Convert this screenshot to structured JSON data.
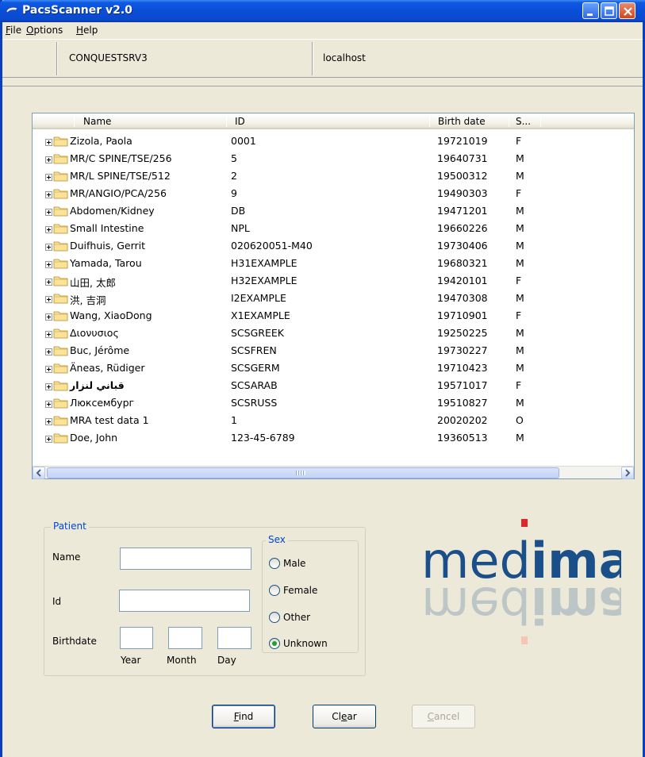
{
  "window": {
    "title": "PacsScanner v2.0"
  },
  "menu": [
    {
      "label": "File",
      "accel": "F",
      "rest": "ile"
    },
    {
      "label": "Options",
      "accel": "O",
      "rest": "ptions"
    },
    {
      "label": "Help",
      "accel": "H",
      "rest": "elp"
    }
  ],
  "server": {
    "ae_title": "CONQUESTSRV3",
    "host": "localhost"
  },
  "tree": {
    "columns": {
      "name": "Name",
      "id": "ID",
      "birth": "Birth date",
      "sex": "S..."
    },
    "rows": [
      {
        "name": "Zizola, Paola",
        "id": "0001",
        "birth": "19721019",
        "sex": "F"
      },
      {
        "name": "MR/C SPINE/TSE/256",
        "id": "5",
        "birth": "19640731",
        "sex": "M"
      },
      {
        "name": "MR/L SPINE/TSE/512",
        "id": "2",
        "birth": "19500312",
        "sex": "M"
      },
      {
        "name": "MR/ANGIO/PCA/256",
        "id": "9",
        "birth": "19490303",
        "sex": "F"
      },
      {
        "name": "Abdomen/Kidney",
        "id": "DB",
        "birth": "19471201",
        "sex": "M"
      },
      {
        "name": "Small Intestine",
        "id": "NPL",
        "birth": "19660226",
        "sex": "M"
      },
      {
        "name": "Duifhuis, Gerrit",
        "id": "020620051-M40",
        "birth": "19730406",
        "sex": "M"
      },
      {
        "name": "Yamada, Tarou",
        "id": "H31EXAMPLE",
        "birth": "19680321",
        "sex": "M"
      },
      {
        "name": "山田, 太郎",
        "id": "H32EXAMPLE",
        "birth": "19420101",
        "sex": "F"
      },
      {
        "name": "洪, 吉洞",
        "id": "I2EXAMPLE",
        "birth": "19470308",
        "sex": "M"
      },
      {
        "name": "Wang, XiaoDong",
        "id": "X1EXAMPLE",
        "birth": "19710901",
        "sex": "F"
      },
      {
        "name": "Διονυσιος",
        "id": "SCSGREEK",
        "birth": "19250225",
        "sex": "M"
      },
      {
        "name": "Buc, Jérôme",
        "id": "SCSFREN",
        "birth": "19730227",
        "sex": "M"
      },
      {
        "name": "Äneas, Rüdiger",
        "id": "SCSGERM",
        "birth": "19710423",
        "sex": "M"
      },
      {
        "name": "قباني لنزار",
        "id": "SCSARAB",
        "birth": "19571017",
        "sex": "F"
      },
      {
        "name": "Люксембург",
        "id": "SCSRUSS",
        "birth": "19510827",
        "sex": "M"
      },
      {
        "name": "MRA test data 1",
        "id": "1",
        "birth": "20020202",
        "sex": "O"
      },
      {
        "name": "Doe, John",
        "id": "123-45-6789",
        "birth": "19360513",
        "sex": "M"
      }
    ]
  },
  "patient": {
    "group_title": "Patient",
    "name_label": "Name",
    "id_label": "Id",
    "birthdate_label": "Birthdate",
    "year_label": "Year",
    "month_label": "Month",
    "day_label": "Day",
    "name_value": "",
    "id_value": "",
    "year_value": "",
    "month_value": "",
    "day_value": ""
  },
  "sex": {
    "group_title": "Sex",
    "options": [
      "Male",
      "Female",
      "Other",
      "Unknown"
    ],
    "selected": "Unknown"
  },
  "logo": {
    "text_dark": "med",
    "text_bold": "ima",
    "dot_color": "#e0252b",
    "reflection_dot_color": "#f7c5b5"
  },
  "buttons": {
    "find": {
      "accel": "F",
      "rest": "ind"
    },
    "clear": {
      "pre": "Cl",
      "accel": "e",
      "rest": "ar"
    },
    "cancel": {
      "accel": "C",
      "rest": "ancel"
    }
  },
  "colors": {
    "titlebar": "#0a4ed8",
    "group_title": "#0046d5",
    "selection_green": "#21a121"
  }
}
